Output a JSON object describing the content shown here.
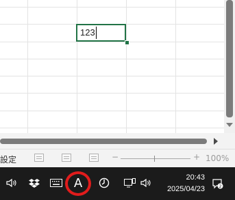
{
  "spreadsheet": {
    "active_cell": {
      "value": "123"
    }
  },
  "statusbar": {
    "mode_text": "設定",
    "zoom": {
      "minus": "−",
      "plus": "+",
      "percent": "100%"
    }
  },
  "taskbar": {
    "icons": {
      "speaker": "speaker-icon",
      "dropbox": "dropbox-icon",
      "keyboard": "keyboard-icon",
      "ime": "ime-mode-icon",
      "clock_app": "moon-clock-icon",
      "network": "network-icon",
      "speaker2": "volume-icon",
      "notifications": "notification-icon"
    },
    "ime_mode": "A",
    "time": "20:43",
    "date": "2025/04/23"
  },
  "colors": {
    "selection": "#217346",
    "ime_highlight": "#e11c1c",
    "taskbar_bg": "#1b1b1b"
  }
}
